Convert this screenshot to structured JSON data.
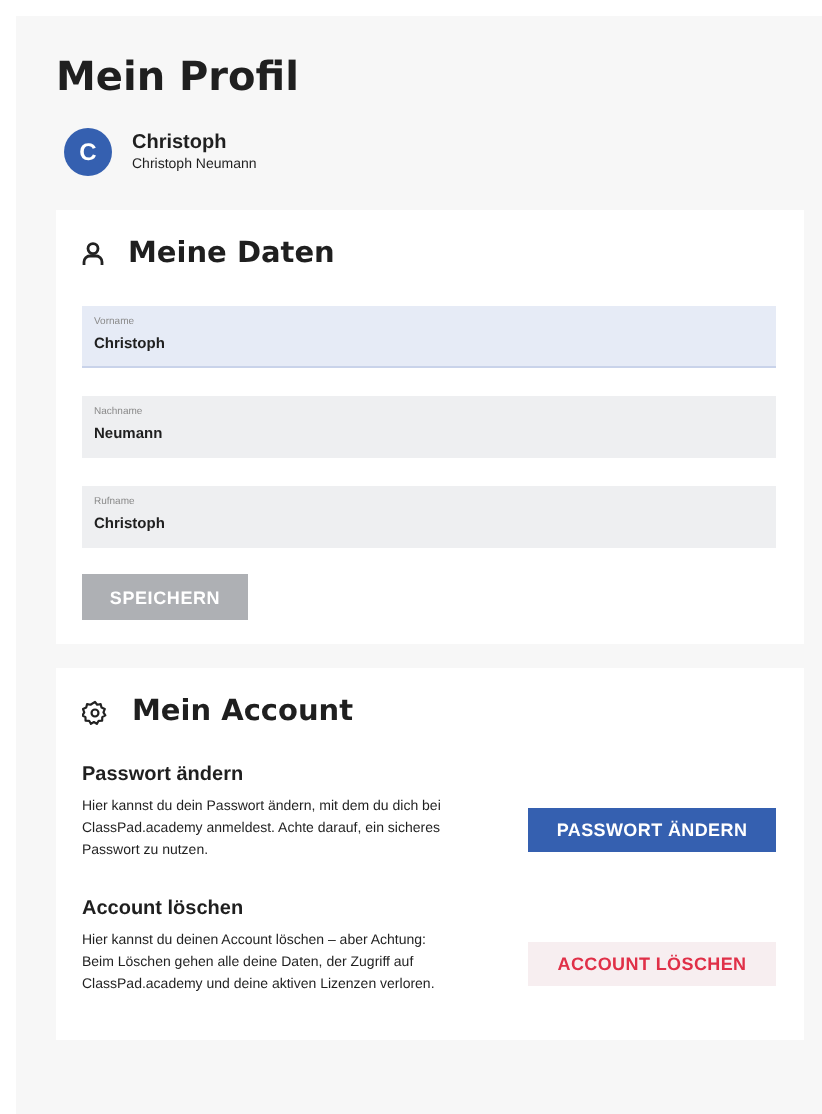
{
  "page_title": "Mein Profil",
  "user": {
    "avatar_letter": "C",
    "name": "Christoph",
    "full_name": "Christoph Neumann"
  },
  "personal_data": {
    "title": "Meine Daten",
    "fields": [
      {
        "label": "Vorname",
        "value": "Christoph",
        "focused": true
      },
      {
        "label": "Nachname",
        "value": "Neumann",
        "focused": false
      },
      {
        "label": "Rufname",
        "value": "Christoph",
        "focused": false
      }
    ],
    "save_button": {
      "label": "SPEICHERN",
      "disabled": true
    }
  },
  "account": {
    "title": "Mein Account",
    "sections": [
      {
        "heading": "Passwort ändern",
        "text": "Hier kannst du dein Passwort ändern, mit dem du dich bei ClassPad.academy anmeldest. Achte darauf, ein sicheres Passwort zu nutzen.",
        "button": "PASSWORT ÄNDERN",
        "kind": "primary"
      },
      {
        "heading": "Account löschen",
        "text": "Hier kannst du deinen Account löschen – aber Achtung: Beim Löschen gehen alle deine Daten, der Zugriff auf ClassPad.academy und deine aktiven Lizenzen verloren.",
        "button": "ACCOUNT LÖSCHEN",
        "kind": "danger"
      }
    ]
  }
}
